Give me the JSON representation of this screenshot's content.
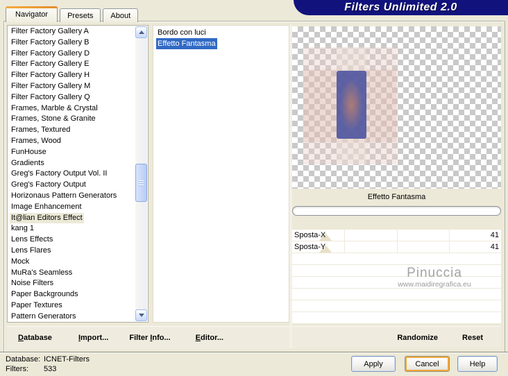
{
  "title_banner": "Filters Unlimited 2.0",
  "tabs": [
    "Navigator",
    "Presets",
    "About"
  ],
  "active_tab": "Navigator",
  "category_list": {
    "items": [
      "Filter Factory Gallery A",
      "Filter Factory Gallery B",
      "Filter Factory Gallery D",
      "Filter Factory Gallery E",
      "Filter Factory Gallery H",
      "Filter Factory Gallery M",
      "Filter Factory Gallery Q",
      "Frames, Marble & Crystal",
      "Frames, Stone & Granite",
      "Frames, Textured",
      "Frames, Wood",
      "FunHouse",
      "Gradients",
      "Greg's Factory Output Vol. II",
      "Greg's Factory Output",
      "Horizonaus Pattern Generators",
      "Image Enhancement",
      "It@lian Editors Effect",
      "kang 1",
      "Lens Effects",
      "Lens Flares",
      "Mock",
      "MuRa's Seamless",
      "Noise Filters",
      "Paper Backgrounds",
      "Paper Textures",
      "Pattern Generators"
    ],
    "selected": "It@lian Editors Effect"
  },
  "filter_list": {
    "items": [
      "Bordo con luci",
      "Effetto Fantasma"
    ],
    "selected": "Effetto Fantasma"
  },
  "preview_label": "Effetto Fantasma",
  "sliders": [
    {
      "label": "Sposta-X",
      "value": "41",
      "thumb_percent": 16
    },
    {
      "label": "Sposta-Y",
      "value": "41",
      "thumb_percent": 16
    }
  ],
  "blank_row_count": 6,
  "watermark": {
    "name": "Pinuccia",
    "url": "www.maidiregrafica.eu"
  },
  "menu_bar": {
    "left": [
      {
        "pre": "",
        "accel": "D",
        "post": "atabase"
      },
      {
        "pre": "",
        "accel": "I",
        "post": "mport..."
      },
      {
        "pre": "Filter ",
        "accel": "I",
        "post": "nfo..."
      },
      {
        "pre": "",
        "accel": "E",
        "post": "ditor..."
      }
    ],
    "right": [
      {
        "label": "Randomize"
      },
      {
        "label": "Reset"
      }
    ]
  },
  "status": {
    "db_label": "Database:",
    "db_value": "ICNET-Filters",
    "count_label": "Filters:",
    "count_value": "533"
  },
  "action_buttons": [
    {
      "label": "Apply",
      "highlighted": false
    },
    {
      "label": "Cancel",
      "highlighted": true
    },
    {
      "label": "Help",
      "highlighted": false
    }
  ],
  "icons": {
    "scroll_up": "triangle-up",
    "scroll_down": "triangle-down"
  },
  "colors": {
    "selection_blue": "#316AC5",
    "banner_navy": "#12127D",
    "tab_accent_orange": "#E68B2C",
    "dialog_beige": "#ECE9D8",
    "focus_ring_orange": "#F1A83B"
  }
}
